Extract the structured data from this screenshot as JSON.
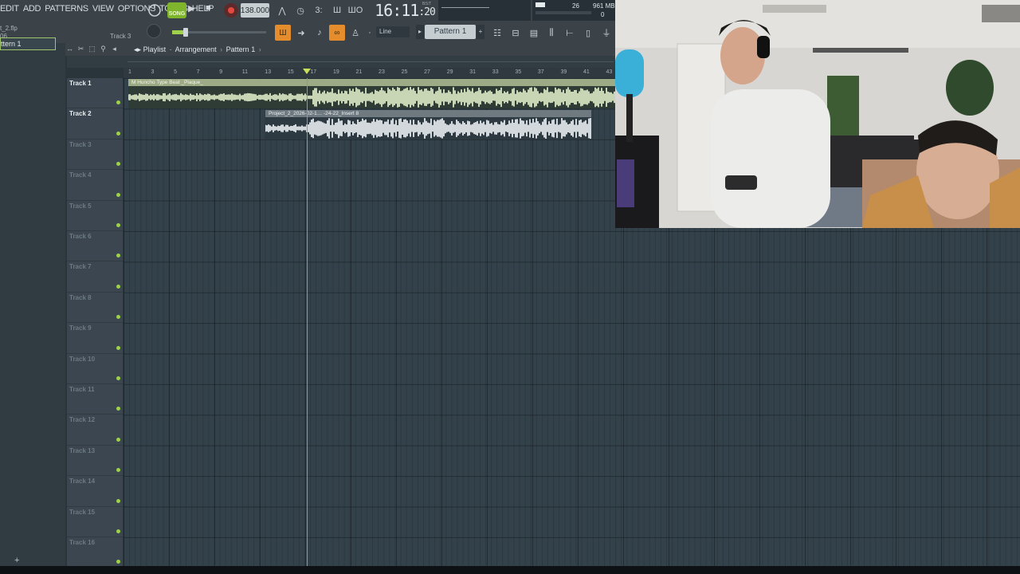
{
  "menu": [
    "EDIT",
    "ADD",
    "PATTERNS",
    "VIEW",
    "OPTIONS",
    "TOOLS",
    "HELP"
  ],
  "transport": {
    "song_label": "SONG",
    "tempo": "138.000",
    "time_main": "16:11",
    "time_sub": ":20",
    "time_unit": "B:S:T"
  },
  "cpu": {
    "value1": "26",
    "memory": "961 MB",
    "value2": "0"
  },
  "toolbar2": {
    "file_title": "t_2.flp",
    "file_time": "06",
    "track_hint": "Track 3",
    "snap": "Line",
    "pattern": "Pattern 1"
  },
  "playlist": {
    "title": "Playlist",
    "view": "Arrangement",
    "pattern": "Pattern 1",
    "left_pattern": "ttern 1",
    "ruler": [
      "1",
      "3",
      "5",
      "7",
      "9",
      "11",
      "13",
      "15",
      "17",
      "19",
      "21",
      "23",
      "25",
      "27",
      "29",
      "31",
      "33",
      "35",
      "37",
      "39",
      "41",
      "43"
    ],
    "tracks": [
      "Track 1",
      "Track 2",
      "Track 3",
      "Track 4",
      "Track 5",
      "Track 6",
      "Track 7",
      "Track 8",
      "Track 9",
      "Track 10",
      "Track 11",
      "Track 12",
      "Track 13",
      "Track 14",
      "Track 15",
      "Track 16"
    ],
    "clips": [
      {
        "name": "M Huncho Type Beat _Plaque_",
        "track": 1
      },
      {
        "name": "Project_2_2026-02-1… -24-22_Insert 8",
        "track": 2
      }
    ]
  },
  "colors": {
    "accent_green": "#9fd24a",
    "clip1": "#c9d6b6",
    "clip2": "#d2d8dc",
    "grid_bg": "#33414a"
  }
}
